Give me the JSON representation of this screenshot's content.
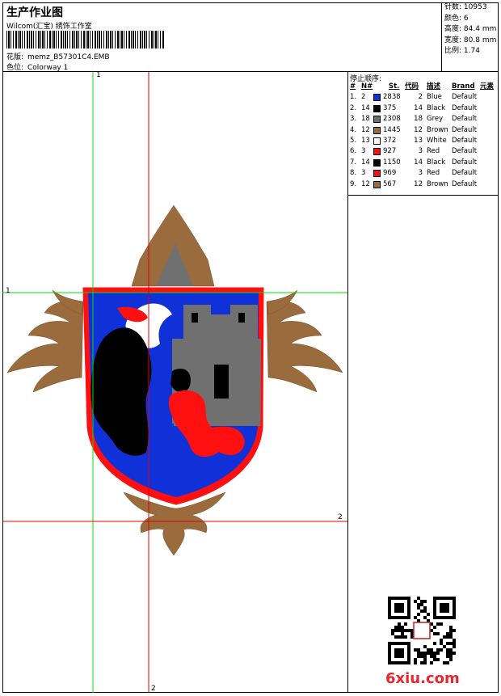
{
  "header": {
    "title": "生产作业图",
    "subtitle": "Wilcom(汇宝) 绣饰工作室",
    "design_label": "花版:",
    "design_value": "memz_B57301C4.EMB",
    "colorway_label": "色位:",
    "colorway_value": "Colorway 1"
  },
  "stats": [
    {
      "label": "针数:",
      "value": "10953"
    },
    {
      "label": "颜色:",
      "value": "6"
    },
    {
      "label": "高度:",
      "value": "84.4 mm"
    },
    {
      "label": "宽度:",
      "value": "80.8 mm"
    },
    {
      "label": "比例:",
      "value": "1.74"
    }
  ],
  "stop_sequence": {
    "title": "停止顺序:",
    "headers": [
      "#",
      "N#",
      "St.",
      "代码",
      "描述",
      "Brand",
      "元素"
    ],
    "rows": [
      {
        "n": "1.",
        "needle": "2",
        "color": "#1030d8",
        "st": "2838",
        "code": "2",
        "desc": "Blue",
        "brand": "Default"
      },
      {
        "n": "2.",
        "needle": "14",
        "color": "#000000",
        "st": "375",
        "code": "14",
        "desc": "Black",
        "brand": "Default"
      },
      {
        "n": "3.",
        "needle": "18",
        "color": "#707070",
        "st": "2308",
        "code": "18",
        "desc": "Grey",
        "brand": "Default"
      },
      {
        "n": "4.",
        "needle": "12",
        "color": "#9a6b3c",
        "st": "1445",
        "code": "12",
        "desc": "Brown",
        "brand": "Default"
      },
      {
        "n": "5.",
        "needle": "13",
        "color": "#ffffff",
        "st": "372",
        "code": "13",
        "desc": "White",
        "brand": "Default"
      },
      {
        "n": "6.",
        "needle": "3",
        "color": "#ff1010",
        "st": "927",
        "code": "3",
        "desc": "Red",
        "brand": "Default"
      },
      {
        "n": "7.",
        "needle": "14",
        "color": "#000000",
        "st": "1150",
        "code": "14",
        "desc": "Black",
        "brand": "Default"
      },
      {
        "n": "8.",
        "needle": "3",
        "color": "#ff1010",
        "st": "969",
        "code": "3",
        "desc": "Red",
        "brand": "Default"
      },
      {
        "n": "9.",
        "needle": "12",
        "color": "#9a6b3c",
        "st": "567",
        "code": "12",
        "desc": "Brown",
        "brand": "Default"
      }
    ]
  },
  "guides": {
    "v1": "1",
    "h1": "1",
    "h2": "2",
    "v2": "2"
  },
  "watermark": "6xiu.com",
  "colors": {
    "guide_green": "#00e000",
    "guide_red": "#e00000"
  }
}
